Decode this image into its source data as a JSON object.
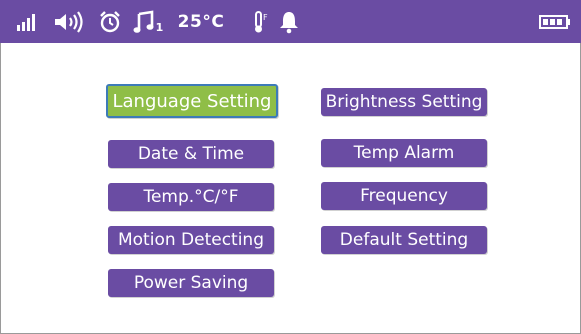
{
  "status_bar": {
    "background": "#6a4ca3",
    "icons": [
      "signal-icon",
      "speaker-icon",
      "alarm-clock-icon",
      "music-note-icon",
      "thermometer-icon",
      "bell-icon",
      "battery-icon"
    ],
    "lullaby_track": "1",
    "temperature": "25°C",
    "thermometer_label": "F"
  },
  "menu": {
    "selected_color": "#8fbe47",
    "item_color": "#6a4ca3",
    "left_column": [
      {
        "label": "Language Setting",
        "selected": true
      },
      {
        "label": "Date & Time"
      },
      {
        "label": "Temp.°C/°F"
      },
      {
        "label": "Motion Detecting"
      },
      {
        "label": "Power Saving"
      }
    ],
    "right_column": [
      {
        "label": "Brightness Setting"
      },
      {
        "label": "Temp Alarm"
      },
      {
        "label": "Frequency"
      },
      {
        "label": "Default Setting"
      }
    ]
  }
}
